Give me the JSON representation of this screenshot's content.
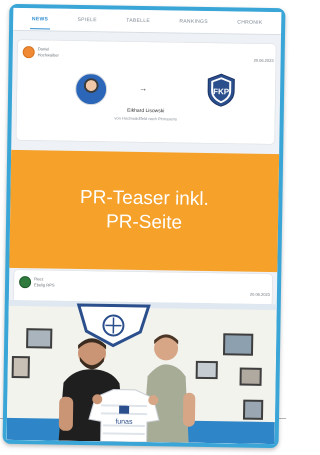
{
  "tabs": [
    {
      "label": "News",
      "active": true
    },
    {
      "label": "Spiele",
      "active": false
    },
    {
      "label": "Tabelle",
      "active": false
    },
    {
      "label": "Rankings",
      "active": false
    },
    {
      "label": "Chronik",
      "active": false
    }
  ],
  "post1": {
    "club_line1": "Daniel",
    "club_line2": "Hochwaiber",
    "date": "20.06.2023",
    "arrow": "→",
    "player_name": "Eikhard Lisowski",
    "transfer_text": "von Hochwaldtfeld nach Pirmasens"
  },
  "teaser": {
    "line1": "PR-Teaser inkl.",
    "line2": "PR-Seite"
  },
  "post2": {
    "club_line1": "Reez",
    "club_line2": "Ebelig RPS",
    "date": "20.06.2023",
    "jersey_text": "funas"
  },
  "colors": {
    "frame": "#3aa6d8",
    "teaser": "#f5a12a",
    "accent": "#2d8ccf"
  }
}
